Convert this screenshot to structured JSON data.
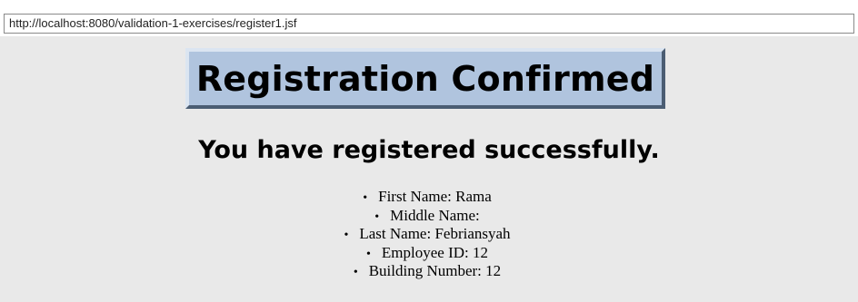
{
  "browser": {
    "url": "http://localhost:8080/validation-1-exercises/register1.jsf"
  },
  "page": {
    "title": "Registration Confirmed",
    "message": "You have registered successfully.",
    "bullet": "•",
    "details": [
      "First Name: Rama",
      "Middle Name:",
      "Last Name: Febriansyah",
      "Employee ID: 12",
      "Building Number: 12"
    ]
  },
  "colors": {
    "page_background": "#e9e9e9",
    "title_background": "#b0c4de"
  }
}
